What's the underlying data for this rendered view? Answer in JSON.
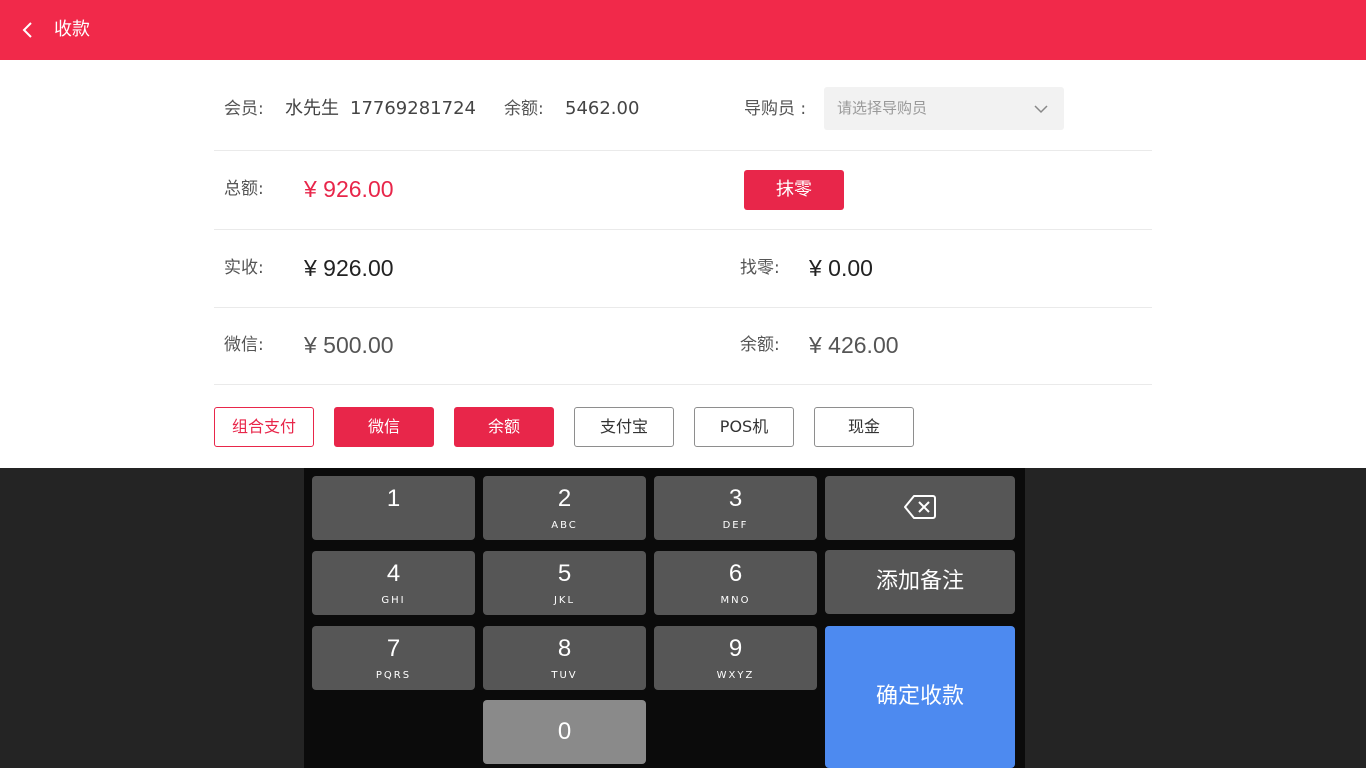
{
  "header": {
    "title": "收款",
    "back_icon": "chevron-left-icon"
  },
  "member": {
    "label": "会员:",
    "name": "水先生",
    "phone": "17769281724",
    "balance_label": "余额:",
    "balance_value": "5462.00"
  },
  "guide": {
    "label": "导购员 :",
    "placeholder": "请选择导购员",
    "icon": "chevron-down-icon"
  },
  "total": {
    "label": "总额:",
    "value": "¥ 926.00",
    "round_off_button": "抹零"
  },
  "received": {
    "label": "实收:",
    "value": "¥ 926.00",
    "change_label": "找零:",
    "change_value": "¥ 0.00"
  },
  "split": {
    "wechat_label": "微信:",
    "wechat_value": "¥ 500.00",
    "balance_label": "余额:",
    "balance_value": "¥ 426.00"
  },
  "payment_methods": [
    {
      "label": "组合支付",
      "state": "outline-active"
    },
    {
      "label": "微信",
      "state": "selected"
    },
    {
      "label": "余额",
      "state": "selected"
    },
    {
      "label": "支付宝",
      "state": "normal"
    },
    {
      "label": "POS机",
      "state": "normal"
    },
    {
      "label": "现金",
      "state": "normal"
    }
  ],
  "keypad": {
    "keys": [
      {
        "digit": "1",
        "letters": ""
      },
      {
        "digit": "2",
        "letters": "ABC"
      },
      {
        "digit": "3",
        "letters": "DEF"
      },
      {
        "digit": "4",
        "letters": "GHI"
      },
      {
        "digit": "5",
        "letters": "JKL"
      },
      {
        "digit": "6",
        "letters": "MNO"
      },
      {
        "digit": "7",
        "letters": "PQRS"
      },
      {
        "digit": "8",
        "letters": "TUV"
      },
      {
        "digit": "9",
        "letters": "WXYZ"
      },
      {
        "digit": "0",
        "letters": ""
      }
    ],
    "backspace_icon": "backspace-icon",
    "add_note": "添加备注",
    "confirm": "确定收款"
  },
  "colors": {
    "brand_red": "#F1294A",
    "accent_red": "#E8264A",
    "confirm_blue": "#4D8AF0",
    "key_grey": "#565656",
    "keypad_bg": "#0B0B0B"
  }
}
